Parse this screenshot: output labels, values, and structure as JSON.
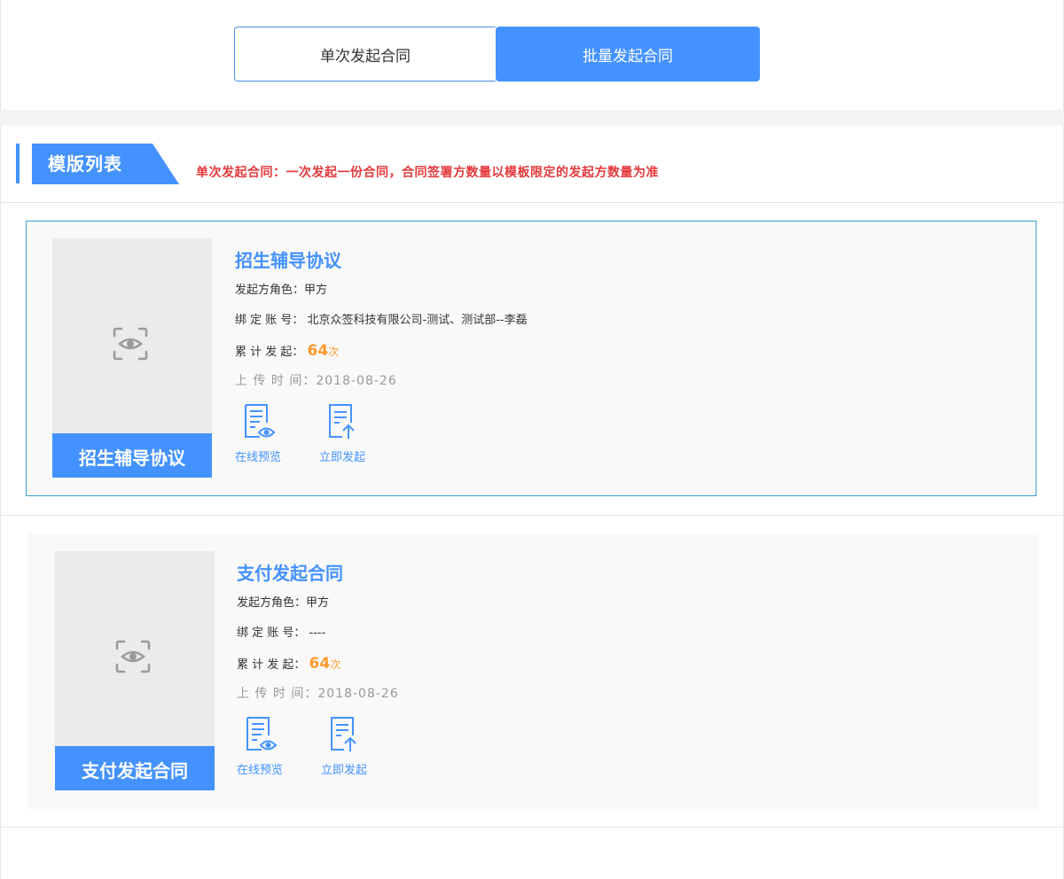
{
  "mode_toggle": {
    "single_label": "单次发起合同",
    "batch_label": "批量发起合同"
  },
  "section": {
    "title": "模版列表",
    "notice": "单次发起合同：一次发起一份合同，合同签署方数量以模板限定的发起方数量为准"
  },
  "labels": {
    "initiator_role": "发起方角色：",
    "bound_account": "绑 定 账 号：",
    "total_initiated": "累 计 发 起：",
    "upload_time": "上 传 时 间：",
    "times_unit": "次",
    "preview": "在线预览",
    "initiate": "立即发起"
  },
  "templates": [
    {
      "name": "招生辅导协议",
      "thumb_caption": "招生辅导协议",
      "initiator_role": "甲方",
      "bound_account": "北京众签科技有限公司-测试、测试部--李磊",
      "total_initiated": "64",
      "upload_time": "2018-08-26"
    },
    {
      "name": "支付发起合同",
      "thumb_caption": "支付发起合同",
      "initiator_role": "甲方",
      "bound_account": "----",
      "total_initiated": "64",
      "upload_time": "2018-08-26"
    }
  ],
  "colors": {
    "accent": "#4492ff",
    "notice": "#e4393c",
    "count": "#ff9a2e",
    "active_border": "#3aa0d8"
  }
}
